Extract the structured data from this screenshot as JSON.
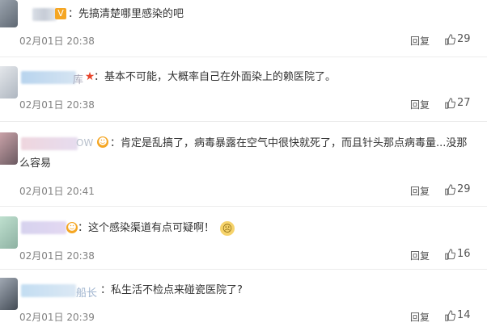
{
  "comments": [
    {
      "text": "：先搞清楚哪里感染的吧",
      "date": "02月01日 20:38",
      "reply": "回复",
      "likes": "29"
    },
    {
      "name_suffix": "库",
      "text": "：基本不可能，大概率自己在外面染上的赖医院了。",
      "date": "02月01日 20:38",
      "reply": "回复",
      "likes": "27"
    },
    {
      "name_suffix": "OW",
      "text": "：肯定是乱搞了，病毒暴露在空气中很快就死了，而且针头那点病毒量...没那",
      "text2": "么容易",
      "date": "02月01日 20:41",
      "reply": "回复",
      "likes": "29"
    },
    {
      "text": "：这个感染渠道有点可疑啊！",
      "date": "02月01日 20:38",
      "reply": "回复",
      "likes": "16"
    },
    {
      "name_suffix": "船长",
      "text": "：私生活不检点来碰瓷医院了?",
      "date": "02月01日 20:39",
      "reply": "回复",
      "likes": "14"
    }
  ],
  "colors": {
    "badge_orange": "#f5a623",
    "badge_red": "#e8452c",
    "text": "#333333",
    "meta": "#808080"
  }
}
